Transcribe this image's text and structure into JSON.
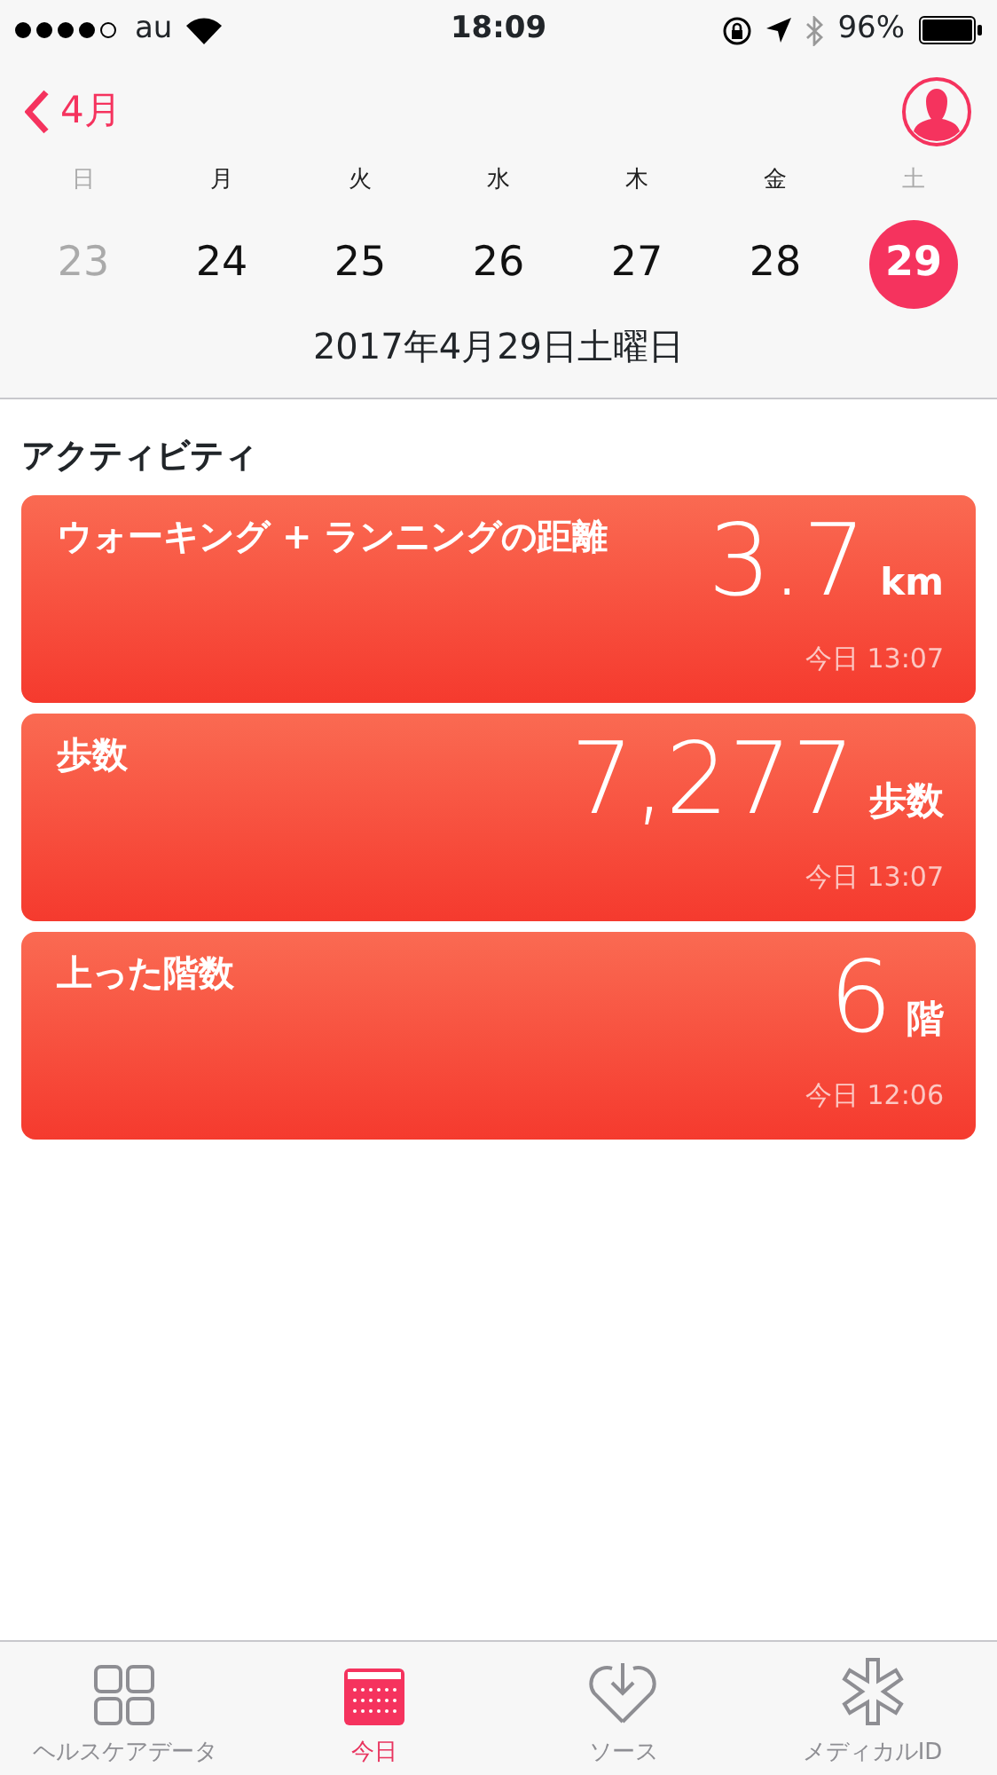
{
  "status_bar": {
    "carrier": "au",
    "time": "18:09",
    "battery": "96%"
  },
  "header": {
    "back_label": "4月"
  },
  "week": [
    {
      "weekday": "日",
      "number": "23",
      "weekend": true,
      "dimmed": true,
      "selected": false
    },
    {
      "weekday": "月",
      "number": "24",
      "weekend": false,
      "dimmed": false,
      "selected": false
    },
    {
      "weekday": "火",
      "number": "25",
      "weekend": false,
      "dimmed": false,
      "selected": false
    },
    {
      "weekday": "水",
      "number": "26",
      "weekend": false,
      "dimmed": false,
      "selected": false
    },
    {
      "weekday": "木",
      "number": "27",
      "weekend": false,
      "dimmed": false,
      "selected": false
    },
    {
      "weekday": "金",
      "number": "28",
      "weekend": false,
      "dimmed": false,
      "selected": false
    },
    {
      "weekday": "土",
      "number": "29",
      "weekend": true,
      "dimmed": false,
      "selected": true
    }
  ],
  "date_title": "2017年4月29日土曜日",
  "section_title": "アクティビティ",
  "cards": [
    {
      "title": "ウォーキング + ランニングの距離",
      "value": "3.7",
      "unit": "km",
      "time": "今日 13:07"
    },
    {
      "title": "歩数",
      "value": "7,277",
      "unit": "歩数",
      "time": "今日 13:07"
    },
    {
      "title": "上った階数",
      "value": "6",
      "unit": "階",
      "time": "今日 12:06"
    }
  ],
  "tabs": [
    {
      "label": "ヘルスケアデータ",
      "kind": "grid",
      "selected": false
    },
    {
      "label": "今日",
      "kind": "calendar",
      "selected": true
    },
    {
      "label": "ソース",
      "kind": "heart",
      "selected": false
    },
    {
      "label": "メディカルID",
      "kind": "asterisk",
      "selected": false
    }
  ]
}
